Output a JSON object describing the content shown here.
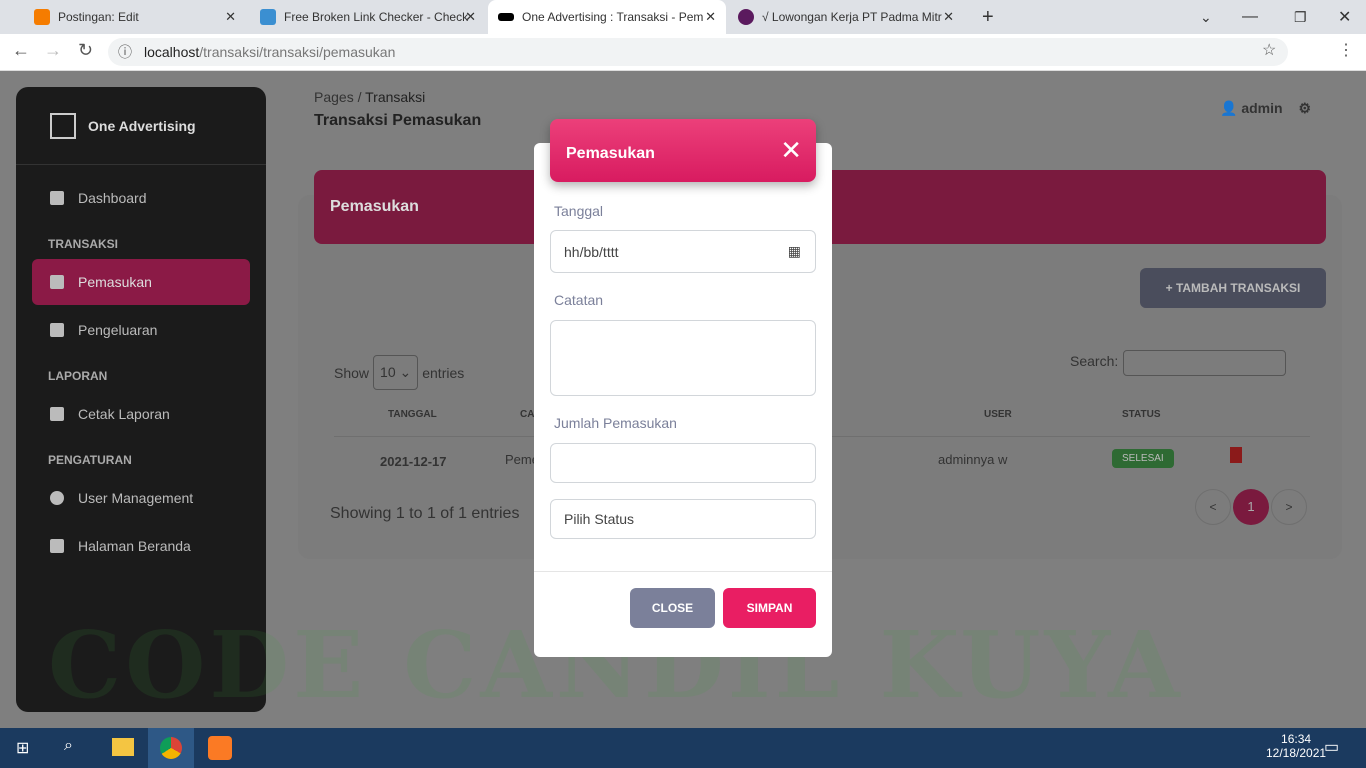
{
  "browser": {
    "tabs": [
      {
        "title": "Postingan: Edit",
        "color": "#f57c00"
      },
      {
        "title": "Free Broken Link Checker - Check",
        "color": "#3b8fd1"
      },
      {
        "title": "One Advertising : Transaksi - Pem",
        "color": "#000000"
      },
      {
        "title": "√ Lowongan Kerja PT Padma Mitr",
        "color": "#5b1a5e"
      }
    ],
    "url_host": "localhost",
    "url_path": "/transaksi/transaksi/pemasukan"
  },
  "sidebar": {
    "brand": "One Advertising",
    "items": [
      {
        "label": "Dashboard"
      }
    ],
    "sections": [
      {
        "title": "TRANSAKSI",
        "items": [
          "Pemasukan",
          "Pengeluaran"
        ]
      },
      {
        "title": "LAPORAN",
        "items": [
          "Cetak Laporan"
        ]
      },
      {
        "title": "PENGATURAN",
        "items": [
          "User Management",
          "Halaman Beranda"
        ]
      }
    ]
  },
  "header": {
    "breadcrumb_root": "Pages",
    "breadcrumb_sep": "/",
    "breadcrumb_current": "Transaksi",
    "title": "Transaksi Pemasukan",
    "user": "admin"
  },
  "card": {
    "title": "Pemasukan",
    "add_button": "+ TAMBAH TRANSAKSI",
    "show_label": "Show",
    "entries_value": "10",
    "entries_label": "entries",
    "search_label": "Search:",
    "columns": [
      "TANGGAL",
      "CA",
      "USER",
      "STATUS"
    ],
    "row": {
      "tanggal": "2021-12-17",
      "catatan": "Peme",
      "user": "adminnya w",
      "status": "SELESAI"
    },
    "info": "Showing 1 to 1 of 1 entries",
    "pagination": [
      "<",
      "1",
      ">"
    ]
  },
  "modal": {
    "title": "Pemasukan",
    "tanggal_label": "Tanggal",
    "tanggal_placeholder": "hh/bb/tttt",
    "catatan_label": "Catatan",
    "jumlah_label": "Jumlah Pemasukan",
    "status_value": "Pilih Status",
    "close": "CLOSE",
    "save": "SIMPAN"
  },
  "watermark": "CODE CANDIL KUYA",
  "taskbar": {
    "time": "16:34",
    "date": "12/18/2021"
  },
  "colors": {
    "accent": "#e91e63",
    "status_green": "#43a047"
  }
}
